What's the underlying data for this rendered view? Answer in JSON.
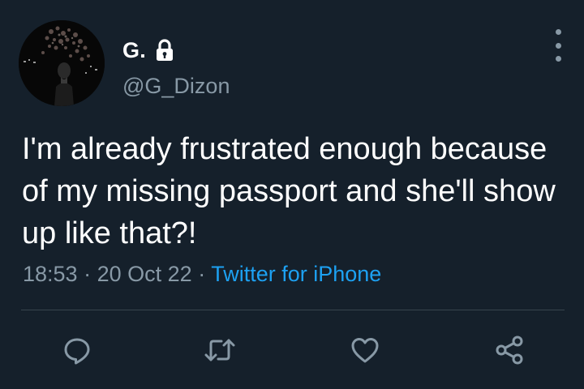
{
  "user": {
    "display_name": "G.",
    "handle": "@G_Dizon",
    "protected_icon": "lock-icon"
  },
  "tweet": {
    "text": "I'm already frustrated enough because of my missing passport and she'll show up like that?!",
    "time": "18:53",
    "date": "20 Oct 22",
    "separator": "·",
    "source": "Twitter for iPhone"
  },
  "actions": [
    {
      "name": "reply",
      "icon": "speech-bubble-icon"
    },
    {
      "name": "retweet",
      "icon": "retweet-arrows-icon"
    },
    {
      "name": "like",
      "icon": "heart-icon"
    },
    {
      "name": "share",
      "icon": "share-nodes-icon"
    }
  ],
  "colors": {
    "background": "#15202b",
    "secondary_text": "#8899a6",
    "link": "#1da1f2",
    "divider": "#38444d"
  }
}
